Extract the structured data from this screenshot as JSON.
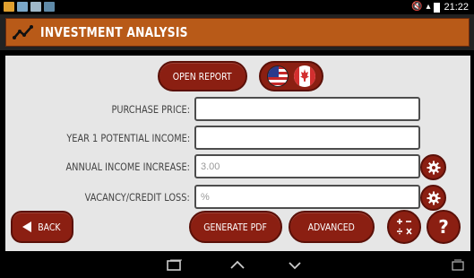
{
  "status_bar": {
    "time": "21:22",
    "icons": [
      "notification-icon",
      "image-icon",
      "image-icon",
      "download-icon"
    ],
    "right_icons": [
      "mute-icon",
      "wifi-icon",
      "battery-icon"
    ]
  },
  "app_bar": {
    "title": "INVESTMENT ANALYSIS",
    "icon": "chart-line-icon"
  },
  "actions": {
    "open_report_label": "OPEN REPORT",
    "flags": [
      "us-flag",
      "canada-flag"
    ]
  },
  "form": {
    "fields": [
      {
        "label": "PURCHASE PRICE:",
        "value": "",
        "placeholder": ""
      },
      {
        "label": "YEAR 1 POTENTIAL INCOME:",
        "value": "",
        "placeholder": ""
      },
      {
        "label": "ANNUAL INCOME INCREASE:",
        "value": "",
        "placeholder": "3.00"
      },
      {
        "label": "VACANCY/CREDIT LOSS:",
        "value": "",
        "placeholder": "%"
      }
    ]
  },
  "bottom_bar": {
    "back_label": "BACK",
    "generate_pdf_label": "GENERATE PDF",
    "advanced_label": "ADVANCED",
    "help_label": "?"
  },
  "colors": {
    "accent": "#8b1f12",
    "appbar": "#b85a18",
    "panel": "#e6e6e6"
  }
}
